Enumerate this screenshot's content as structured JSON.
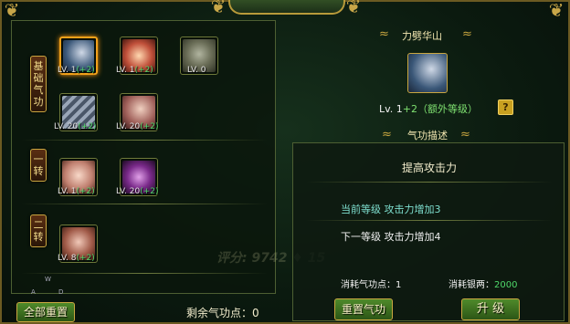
{
  "title": "",
  "left": {
    "tiers": [
      {
        "label": "基\n础\n气\n功"
      },
      {
        "label": "一\n转"
      },
      {
        "label": "二\n转"
      }
    ],
    "skills": [
      {
        "level": "LV. 1",
        "bonus": "(+2)",
        "selected": true
      },
      {
        "level": "LV. 1",
        "bonus": "(+2)"
      },
      {
        "level": "LV. 0",
        "bonus": ""
      },
      {
        "level": "LV. 20",
        "bonus": "(+2)"
      },
      {
        "level": "LV. 20",
        "bonus": "(+2)"
      },
      {
        "level": "LV. 1",
        "bonus": "(+2)"
      },
      {
        "level": "LV. 20",
        "bonus": "(+2)"
      },
      {
        "level": "LV. 8",
        "bonus": "(+2)"
      }
    ],
    "reset_all_label": "全部重置",
    "remaining_label": "剩余气功点：0",
    "watermark": "评分: 9742 ♦ 15",
    "compass": {
      "n": "W",
      "s": "D",
      "w": "A"
    }
  },
  "right": {
    "skill_name": "力劈华山",
    "level_text": "Lv. 1",
    "level_bonus": "+2（额外等级）",
    "help_icon": "?",
    "desc_header": "气功描述",
    "desc_title": "提高攻击力",
    "current_level": "当前等级  攻击力增加3",
    "next_level": "下一等级  攻击力增加4",
    "cost_points_label": "消耗气功点：",
    "cost_points_value": "1",
    "cost_silver_label": "消耗银两：",
    "cost_silver_value": "2000",
    "reset_label": "重置气功",
    "upgrade_label": "升 级"
  },
  "colors": {
    "accent_gold": "#c9a640",
    "bonus_green": "#4fd86a",
    "current_teal": "#7fe0d0"
  }
}
